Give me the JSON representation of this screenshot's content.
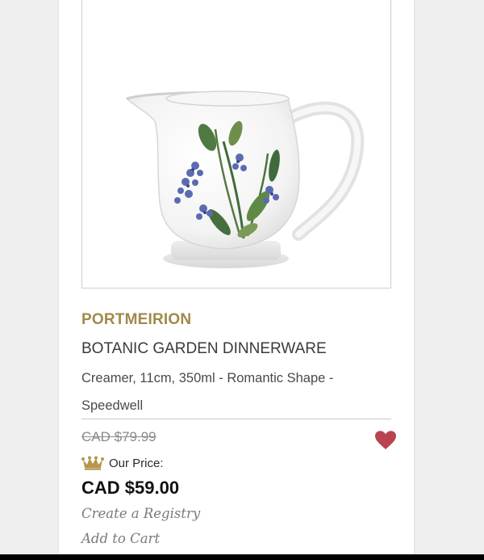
{
  "product": {
    "brand": "PORTMEIRION",
    "collection": "BOTANIC GARDEN DINNERWARE",
    "description": "Creamer, 11cm, 350ml - Romantic Shape - Speedwell",
    "original_price": "CAD $79.99",
    "our_price_label": "Our Price:",
    "sale_price": "CAD $59.00"
  },
  "actions": {
    "registry_label": "Create a Registry",
    "cart_label": "Add to Cart"
  },
  "icons": {
    "wishlist": "heart-icon",
    "price_badge": "crown-icon"
  },
  "colors": {
    "brand_gold": "#a08a4a",
    "heart_red": "#b9434f",
    "crown_gold": "#b7954a"
  }
}
